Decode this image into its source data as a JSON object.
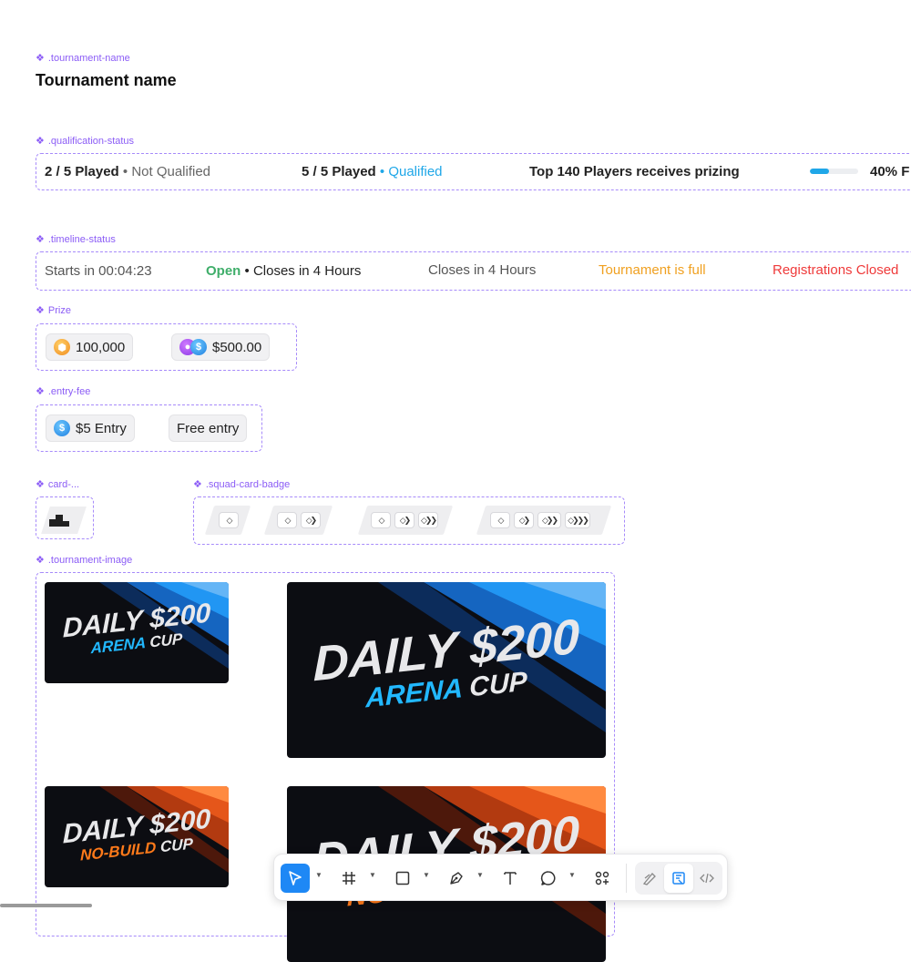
{
  "components": {
    "tournament_name": ".tournament-name",
    "qualification_status": ".qualification-status",
    "timeline_status": ".timeline-status",
    "prize": "Prize",
    "entry_fee": ".entry-fee",
    "card": "card-...",
    "squad_card_badge": ".squad-card-badge",
    "tournament_image": ".tournament-image"
  },
  "tournament_name": "Tournament name",
  "qualification": {
    "a_played": "2 / 5 Played",
    "a_sep": " • ",
    "a_status": "Not Qualified",
    "b_played": "5 / 5 Played",
    "b_sep": " • ",
    "b_status": "Qualified",
    "prizing": "Top 140 Players receives prizing",
    "progress_percent": 40,
    "progress_text": "40% F"
  },
  "timeline": {
    "starts": "Starts in 00:04:23",
    "open": "Open",
    "open_sep": " • ",
    "open_closes": "Closes in 4 Hours",
    "closes": "Closes in 4 Hours",
    "full": "Tournament is full",
    "closed": "Registrations Closed"
  },
  "prize": {
    "coins": "100,000",
    "cash": "$500.00"
  },
  "entry_fee": {
    "paid": "$5 Entry",
    "free": "Free entry"
  },
  "banners": {
    "arena_line1": "DAILY $200",
    "arena_line2a": "ARENA",
    "arena_line2b": "CUP",
    "nobuild_line1": "DAILY $200",
    "nobuild_line2a": "NO-BUILD",
    "nobuild_line2b": "CUP"
  },
  "colors": {
    "accent": "#8b5cf6",
    "qualified": "#1fa7e8",
    "open": "#3fae6a",
    "full": "#f0a020",
    "closed": "#ef3a3a",
    "toolbar_active": "#1e88f5"
  },
  "toolbar": {
    "tools": [
      "move-tool",
      "frame-tool",
      "shape-tool",
      "pen-tool",
      "text-tool",
      "comment-tool",
      "actions-tool"
    ],
    "modes": [
      "draw-mode",
      "design-mode",
      "dev-mode"
    ]
  }
}
